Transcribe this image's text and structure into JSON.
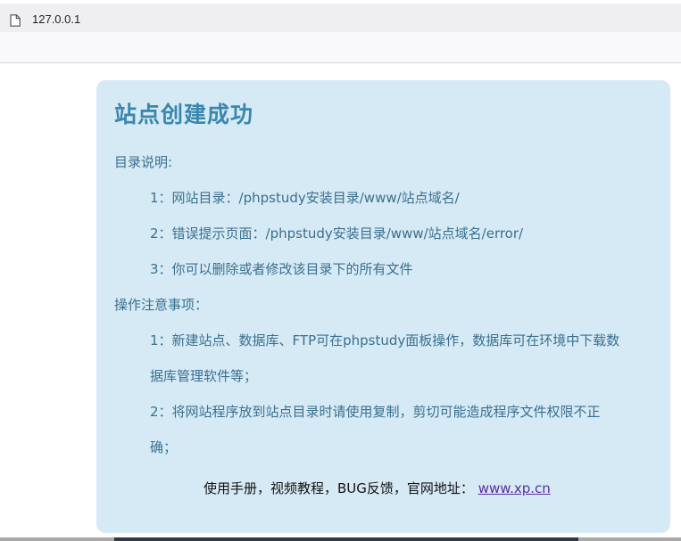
{
  "browser": {
    "url": "127.0.0.1"
  },
  "page": {
    "title": "站点创建成功",
    "directory_heading": "目录说明:",
    "directory_items": [
      "1：网站目录：/phpstudy安装目录/www/站点域名/",
      "2：错误提示页面：/phpstudy安装目录/www/站点域名/error/",
      "3：你可以删除或者修改该目录下的所有文件"
    ],
    "notes_heading": "操作注意事项：",
    "notes_lines": [
      "1：新建站点、数据库、FTP可在phpstudy面板操作，数据库可在环境中下载数",
      "据库管理软件等；",
      "2：将网站程序放到站点目录时请使用复制，剪切可能造成程序文件权限不正",
      "确；"
    ],
    "footer_text": "使用手册，视频教程，BUG反馈，官网地址：",
    "footer_link": "www.xp.cn"
  },
  "colors": {
    "card_background": "#d6eaf5",
    "title": "#3a87ad",
    "body_text": "#3a6f8e",
    "link": "#5a2da0"
  },
  "icons": {
    "page_icon": "page-icon"
  }
}
